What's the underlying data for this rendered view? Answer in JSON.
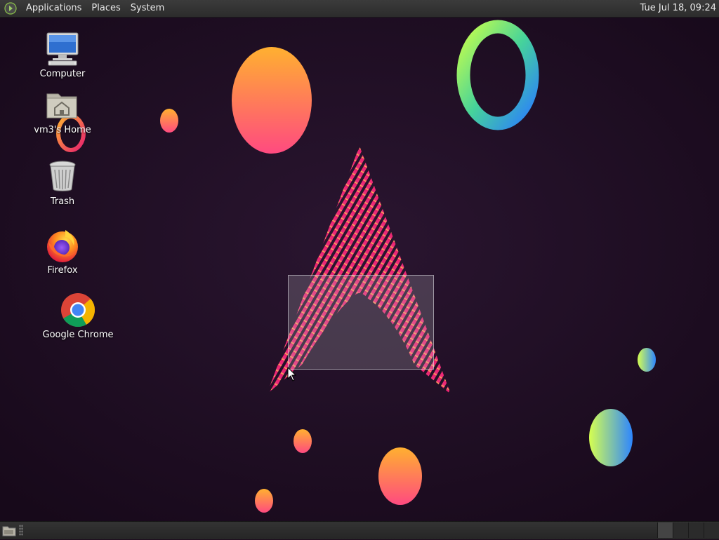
{
  "top_panel": {
    "menus": [
      "Applications",
      "Places",
      "System"
    ],
    "clock": "Tue Jul 18, 09:24",
    "logo_icon": "mate-menu-icon"
  },
  "desktop_icons": [
    {
      "label": "Computer",
      "icon": "computer-icon"
    },
    {
      "label": "vm3's Home",
      "icon": "home-folder-icon"
    },
    {
      "label": "Trash",
      "icon": "trash-icon"
    },
    {
      "label": "Firefox",
      "icon": "firefox-icon"
    },
    {
      "label": "Google Chrome",
      "icon": "chrome-icon"
    }
  ],
  "bottom_panel": {
    "show_desktop_icon": "show-desktop-icon",
    "workspace_count": 4
  },
  "colors": {
    "wallpaper_bg": "#1d0c1f",
    "accent_pink": "#e8206e",
    "accent_orange": "#ffa333",
    "accent_green": "#c6ff5a",
    "accent_blue": "#2f8cff"
  }
}
